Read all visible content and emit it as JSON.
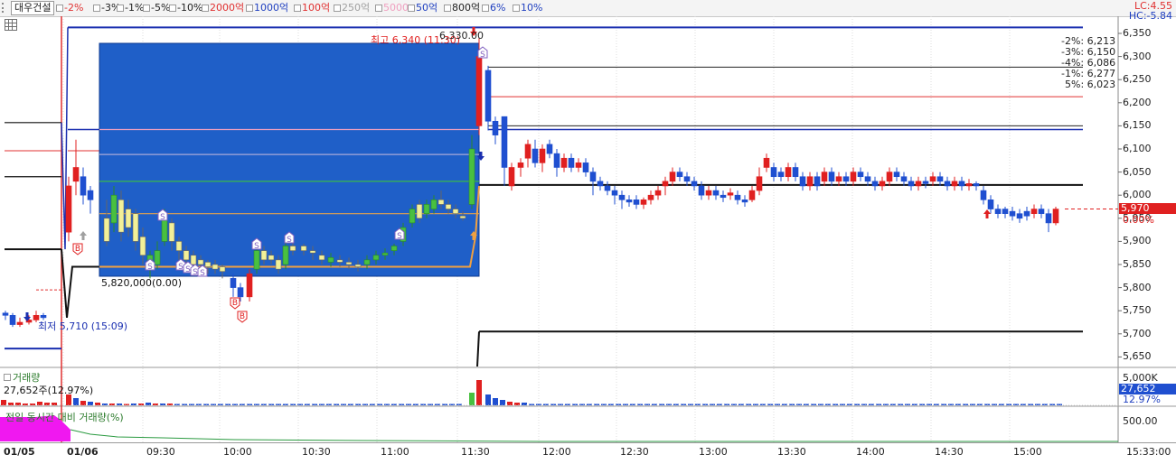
{
  "toolbar": {
    "stock_name": "대우건설",
    "options": [
      {
        "label": "-2%",
        "color": "#e03030"
      },
      {
        "label": "-3%",
        "color": "#222222"
      },
      {
        "label": "-1%",
        "color": "#222222"
      },
      {
        "label": "-5%",
        "color": "#222222"
      },
      {
        "label": "-10%",
        "color": "#222222"
      },
      {
        "label": "2000억",
        "color": "#e03030"
      },
      {
        "label": "1000억",
        "color": "#2040c0"
      },
      {
        "label": "100억",
        "color": "#e03030"
      },
      {
        "label": "250억",
        "color": "#a0a0a0"
      },
      {
        "label": "5000",
        "color": "#f0a0c0"
      },
      {
        "label": "50억",
        "color": "#2040c0"
      },
      {
        "label": "800억",
        "color": "#222222"
      },
      {
        "label": "6%",
        "color": "#2040c0"
      },
      {
        "label": "10%",
        "color": "#2040c0"
      }
    ],
    "lc": "LC:4.55",
    "hc": "HC:-5.84"
  },
  "price_axis": {
    "ticks": [
      "6,350",
      "6,300",
      "6,250",
      "6,200",
      "6,150",
      "6,100",
      "6,050",
      "6,000",
      "5,950",
      "5,900",
      "5,850",
      "5,800",
      "5,750",
      "5,700",
      "5,650"
    ],
    "current_price": "5,970",
    "current_change": "0.00%"
  },
  "target_lines": [
    {
      "label": "-2%: 6,213",
      "color": "#e03030"
    },
    {
      "label": "-3%: 6,150",
      "color": "#222222"
    },
    {
      "label": "-4%: 6,086",
      "color": "#222222"
    },
    {
      "label": "-1%: 6,277",
      "color": "#222222"
    },
    {
      "label": "5%: 6,023",
      "color": "#222222"
    }
  ],
  "annotations": {
    "high": "최고 6,340 (11:30)",
    "high_price": "6,330.00",
    "low": "최저 5,710 (15:09)",
    "box_low": "5,820,000(0.00)"
  },
  "volume_panel": {
    "title": "거래량",
    "value": "27,652주(12.97%)",
    "axis_max": "5,000K",
    "tag_value": "27,652",
    "tag_pct": "12.97%"
  },
  "ratio_panel": {
    "title": "전일 동시간 대비 거래량(%)",
    "axis_value": "500.00"
  },
  "time_axis": {
    "labels": [
      "01/05",
      "01/06",
      "09:30",
      "10:00",
      "10:30",
      "11:00",
      "11:30",
      "12:00",
      "12:30",
      "13:00",
      "13:30",
      "14:00",
      "14:30",
      "15:00"
    ],
    "clock": "15:33:00"
  },
  "colors": {
    "up": "#e02020",
    "down": "#1f4fd0",
    "box": "#1f5fc8",
    "yellow_candle": "#f2f098",
    "green_candle": "#49c040",
    "ratio_area": "#f018f0"
  }
}
